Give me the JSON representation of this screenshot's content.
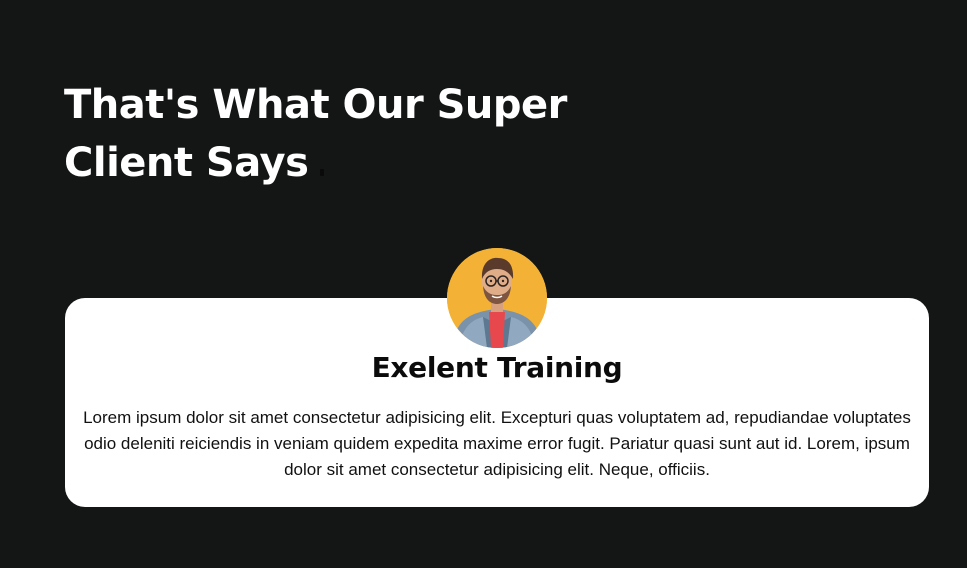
{
  "section": {
    "title_line1": "That's What Our Super",
    "title_line2": "Client Says"
  },
  "testimonial": {
    "avatar_icon": "client-avatar-photo",
    "title": "Exelent Training",
    "text": "Lorem ipsum dolor sit amet consectetur adipisicing elit. Excepturi quas voluptatem ad, repudiandae voluptates odio deleniti reiciendis in veniam quidem expedita maxime error fugit. Pariatur quasi sunt aut id. Lorem, ipsum dolor sit amet consectetur adipisicing elit. Neque, officiis."
  },
  "colors": {
    "page_background": "#141515",
    "card_background": "#ffffff",
    "avatar_background": "#f3b236",
    "heading_text": "#ffffff",
    "card_text": "#111111"
  }
}
